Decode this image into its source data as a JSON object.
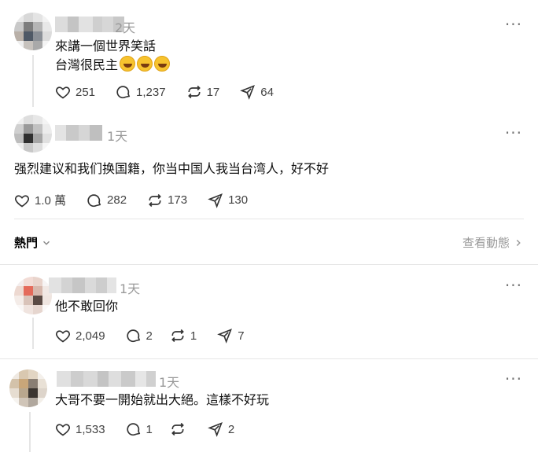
{
  "posts": [
    {
      "time": "2天",
      "lines": [
        "來講一個世界笑話",
        "台灣很民主"
      ],
      "emojis": [
        "rolling-on-floor-laughing-icon",
        "rolling-on-floor-laughing-icon",
        "rolling-on-floor-laughing-icon"
      ],
      "likes": "251",
      "replies": "1,237",
      "reposts": "17",
      "shares": "64"
    },
    {
      "time": "1天",
      "lines": [
        "强烈建议和我们换国籍，你当中国人我当台湾人，好不好"
      ],
      "likes": "1.0 萬",
      "replies": "282",
      "reposts": "173",
      "shares": "130"
    },
    {
      "time": "1天",
      "lines": [
        "他不敢回你"
      ],
      "likes": "2,049",
      "replies": "2",
      "reposts": "1",
      "shares": "7"
    },
    {
      "time": "1天",
      "lines": [
        "大哥不要一開始就出大絕。這樣不好玩"
      ],
      "likes": "1,533",
      "replies": "1",
      "reposts": "",
      "shares": "2"
    }
  ],
  "section": {
    "sort_label": "熱門",
    "activity_label": "查看動態"
  },
  "colors": {
    "text": "#101010",
    "muted": "#999999",
    "icon": "#424242",
    "divider": "#e6e6e6"
  }
}
